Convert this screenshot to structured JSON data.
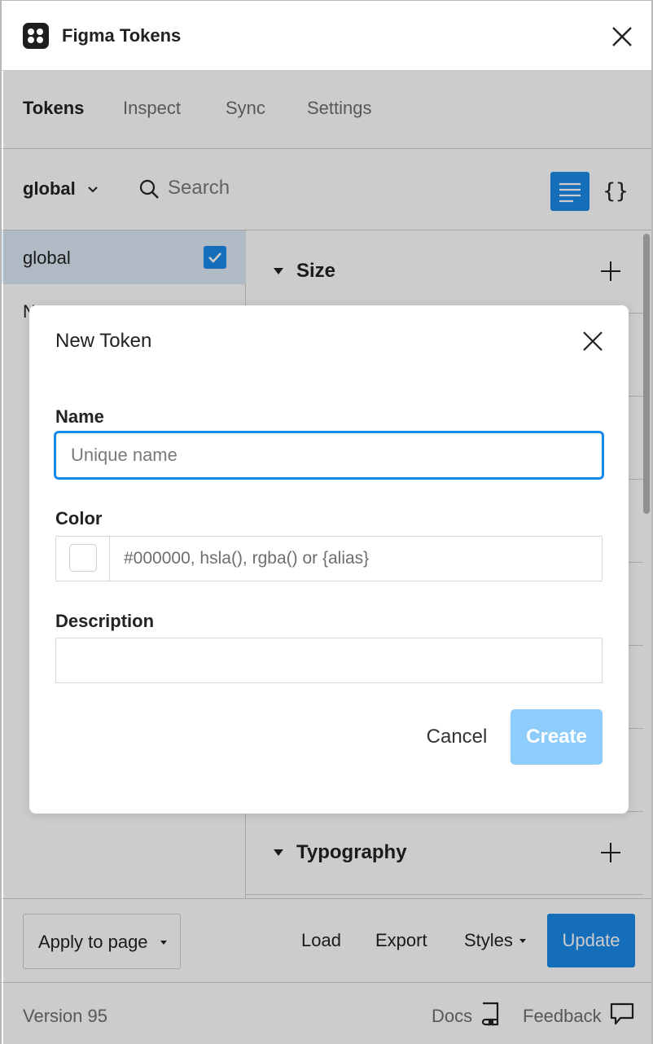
{
  "window": {
    "title": "Figma Tokens",
    "logo_icon": "figma-tokens-logo-icon",
    "close_icon": "close-icon"
  },
  "tabs": [
    {
      "label": "Tokens",
      "active": true
    },
    {
      "label": "Inspect",
      "active": false
    },
    {
      "label": "Sync",
      "active": false
    },
    {
      "label": "Settings",
      "active": false
    }
  ],
  "toolbar": {
    "set_selector": "global",
    "search_placeholder": "Search",
    "list_view_icon": "list-icon",
    "json_view_label": "{}"
  },
  "token_sets": [
    {
      "name": "global",
      "checked": true
    },
    {
      "name": "N",
      "checked": false
    }
  ],
  "groups": [
    {
      "title": "Size"
    },
    {
      "title": "Typography"
    }
  ],
  "footer": {
    "apply_label": "Apply to page",
    "load_label": "Load",
    "export_label": "Export",
    "styles_label": "Styles",
    "update_label": "Update"
  },
  "statusbar": {
    "version": "Version 95",
    "docs_label": "Docs",
    "feedback_label": "Feedback"
  },
  "modal": {
    "title": "New Token",
    "name_label": "Name",
    "name_placeholder": "Unique name",
    "color_label": "Color",
    "color_placeholder": "#000000, hsla(), rgba() or {alias}",
    "description_label": "Description",
    "cancel_label": "Cancel",
    "create_label": "Create"
  },
  "colors": {
    "accent": "#1a8ae8",
    "create_disabled": "#8ecdfb",
    "selected_set": "#dbe9f6"
  }
}
